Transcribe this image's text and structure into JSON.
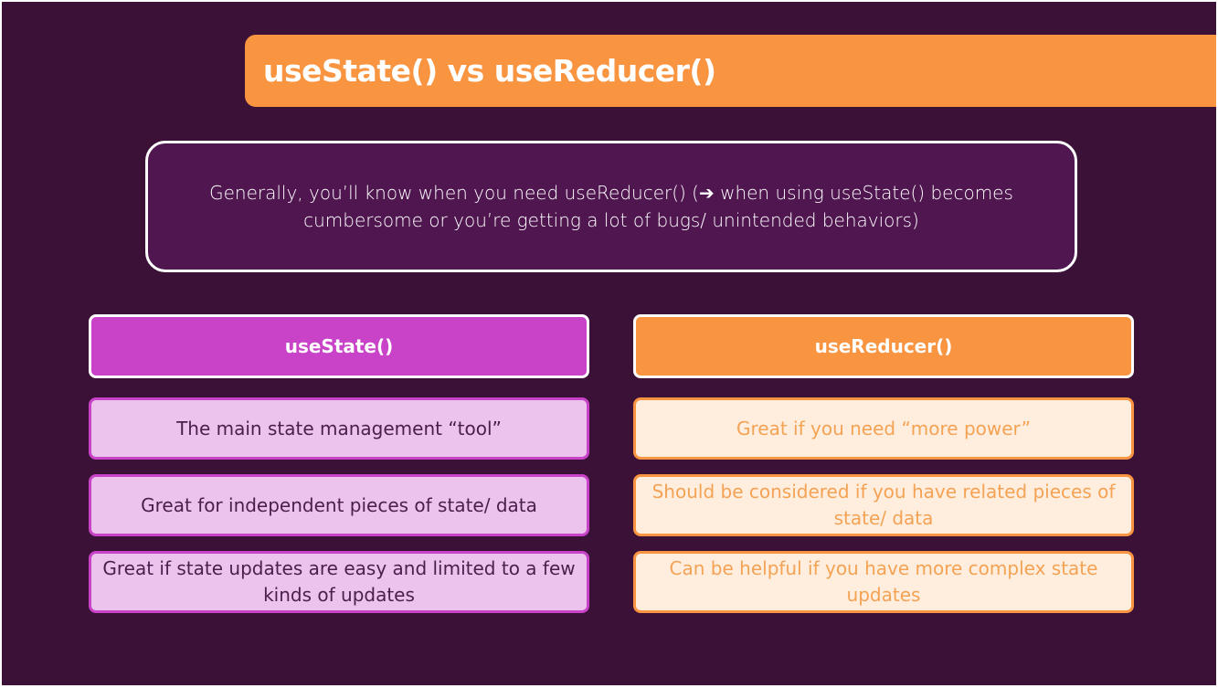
{
  "slide": {
    "title": "useState() vs useReducer()",
    "intro": "Generally, you’ll know when you need useReducer() (➔ when using useState() becomes cumbersome or you’re getting a lot of bugs/ unintended behaviors)"
  },
  "columns": [
    {
      "header": "useState()",
      "color": "#c843c8",
      "items": [
        "The main state management “tool”",
        "Great for independent pieces of state/ data",
        "Great if state updates are easy and limited to a few kinds of updates"
      ]
    },
    {
      "header": "useReducer()",
      "color": "#f99441",
      "items": [
        "Great if you need “more power”",
        "Should be considered if you have related pieces of state/ data",
        "Can be helpful if you have more complex state updates"
      ]
    }
  ],
  "colors": {
    "background": "#3b1138",
    "accent_orange": "#f99441",
    "accent_purple": "#c843c8"
  }
}
